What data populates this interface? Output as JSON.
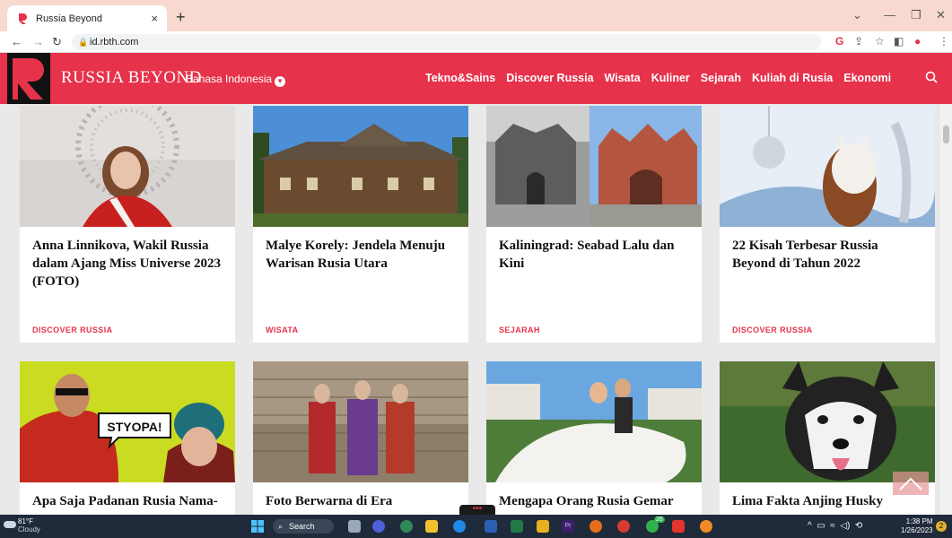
{
  "browser": {
    "tab_title": "Russia Beyond",
    "tab_close": "×",
    "new_tab": "+",
    "url": "id.rbth.com",
    "win_min": "—",
    "win_restore": "❐",
    "win_close": "✕",
    "tab_list": "⌄"
  },
  "site": {
    "logo_text": "RUSSIA BEYOND",
    "language": "Bahasa Indonesia",
    "brand_color": "#e6324b",
    "nav": [
      "Tekno&Sains",
      "Discover Russia",
      "Wisata",
      "Kuliner",
      "Sejarah",
      "Kuliah di Rusia",
      "Ekonomi"
    ]
  },
  "cards": [
    {
      "title": "Anna Linnikova, Wakil Russia dalam Ajang Miss Universe 2023 (FOTO)",
      "category": "DISCOVER RUSSIA"
    },
    {
      "title": "Malye Korely: Jendela Menuju Warisan Rusia Utara",
      "category": "WISATA"
    },
    {
      "title": "Kaliningrad: Seabad Lalu dan Kini",
      "category": "SEJARAH"
    },
    {
      "title": "22 Kisah Terbesar Russia Beyond di Tahun 2022",
      "category": "DISCOVER RUSSIA"
    },
    {
      "title": "Apa Saja Padanan Rusia Nama-",
      "category": "",
      "image_text": "STYOPA!"
    },
    {
      "title": "Foto Berwarna di Era",
      "category": ""
    },
    {
      "title": "Mengapa Orang Rusia Gemar",
      "category": ""
    },
    {
      "title": "Lima Fakta Anjing Husky",
      "category": ""
    }
  ],
  "taskbar": {
    "weather_temp": "81°F",
    "weather_desc": "Cloudy",
    "search_label": "Search",
    "time": "1:38 PM",
    "date": "1/26/2023",
    "badge_count": "2",
    "app_badge": "26"
  }
}
